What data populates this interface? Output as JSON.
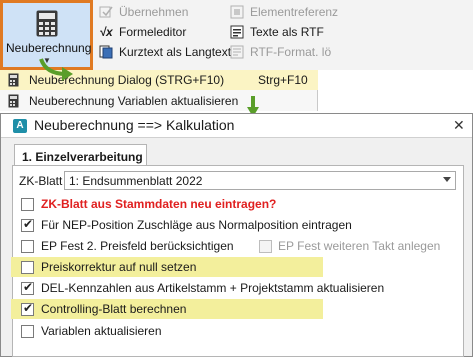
{
  "ribbon": {
    "main_button_label": "Neuberechnung",
    "col2": [
      {
        "label": "Übernehmen",
        "disabled": true,
        "icon": "apply-icon"
      },
      {
        "label": "Formeleditor",
        "disabled": false,
        "icon": "formula-icon"
      },
      {
        "label": "Kurztext als Langtext",
        "disabled": false,
        "icon": "text-copy-icon"
      }
    ],
    "col3": [
      {
        "label": "Elementreferenz",
        "disabled": true,
        "icon": "element-icon"
      },
      {
        "label": "Texte als RTF",
        "disabled": false,
        "icon": "rtf-icon"
      },
      {
        "label": "RTF-Format. lö",
        "disabled": true,
        "icon": "rtf-format-icon"
      }
    ]
  },
  "menu": {
    "items": [
      {
        "label": "Neuberechnung Dialog (STRG+F10)",
        "shortcut": "Strg+F10",
        "highlighted": true
      },
      {
        "label": "Neuberechnung Variablen aktualisieren",
        "shortcut": "",
        "highlighted": false
      }
    ]
  },
  "dialog": {
    "title": "Neuberechnung ==> Kalkulation",
    "close_glyph": "✕",
    "tab_label": "1. Einzelverarbeitung",
    "zk_label": "ZK-Blatt",
    "zk_value": "1: Endsummenblatt 2022",
    "options": [
      {
        "label": "ZK-Blatt aus Stammdaten neu eintragen?",
        "checked": false,
        "emphasis": true,
        "highlighted": false
      },
      {
        "label": "Für NEP-Position Zuschläge aus Normalposition eintragen",
        "checked": true,
        "emphasis": false,
        "highlighted": false
      },
      {
        "label": "EP Fest 2. Preisfeld berücksichtigen",
        "checked": false,
        "emphasis": false,
        "highlighted": false
      },
      {
        "label": "Preiskorrektur auf null setzen",
        "checked": false,
        "emphasis": false,
        "highlighted": true
      },
      {
        "label": "DEL-Kennzahlen aus Artikelstamm + Projektstamm aktualisieren",
        "checked": true,
        "emphasis": false,
        "highlighted": false
      },
      {
        "label": "Controlling-Blatt berechnen",
        "checked": true,
        "emphasis": false,
        "highlighted": true
      },
      {
        "label": "Variablen aktualisieren",
        "checked": false,
        "emphasis": false,
        "highlighted": false
      }
    ],
    "ep_fest_takt_label": "EP Fest weiteren Takt anlegen"
  },
  "colors": {
    "ribbon_highlight": "#cfe2f6",
    "orange_border": "#e07a22",
    "arrow_green": "#5a9e2a",
    "yellow_highlight": "#f3ef9c"
  }
}
